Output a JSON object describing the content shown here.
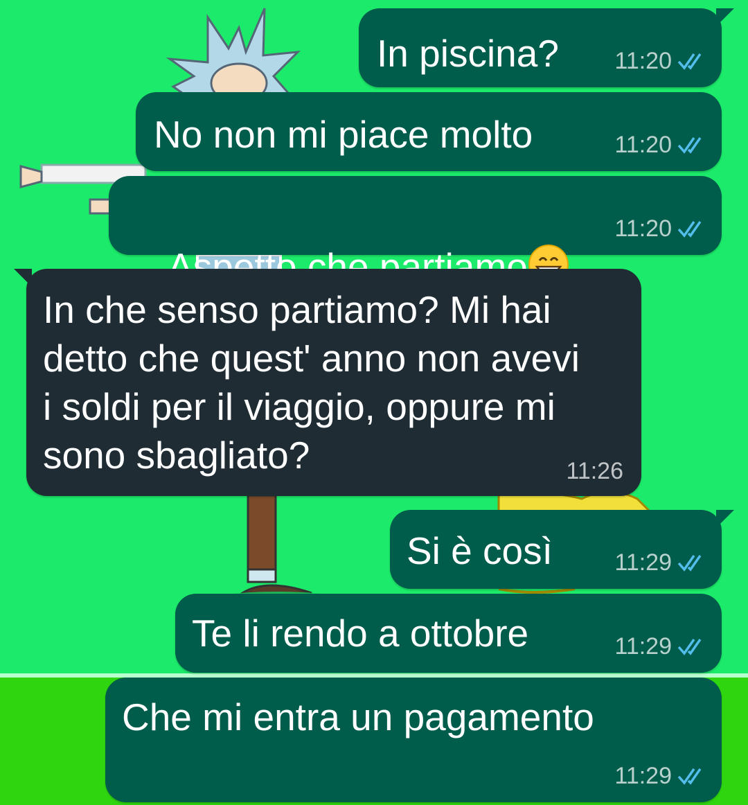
{
  "colors": {
    "wallpaper": "#1cea6a",
    "floor": "#2fd610",
    "outgoing_bubble": "#005c4b",
    "incoming_bubble": "#1f2c33",
    "read_ticks": "#53bdeb"
  },
  "messages": [
    {
      "direction": "outgoing",
      "text": "In piscina?",
      "time": "11:20",
      "status_icon": "double-check-read-icon"
    },
    {
      "direction": "outgoing",
      "text": "No non mi piace molto",
      "time": "11:20",
      "status_icon": "double-check-read-icon"
    },
    {
      "direction": "outgoing",
      "text": "Aspetto che partiamo",
      "emoji": "grinning-face-emoji-icon",
      "time": "11:20",
      "status_icon": "double-check-read-icon"
    },
    {
      "direction": "incoming",
      "text": "In che senso partiamo? Mi hai\ndetto che quest' anno non avevi\ni soldi per il viaggio, oppure mi\nsono sbagliato?",
      "time": "11:26"
    },
    {
      "direction": "outgoing",
      "text": "Si è così",
      "time": "11:29",
      "status_icon": "double-check-read-icon"
    },
    {
      "direction": "outgoing",
      "text": "Te li rendo a ottobre",
      "time": "11:29",
      "status_icon": "double-check-read-icon"
    },
    {
      "direction": "outgoing",
      "text": "Che mi entra un pagamento",
      "time": "11:29",
      "status_icon": "double-check-read-icon"
    }
  ]
}
